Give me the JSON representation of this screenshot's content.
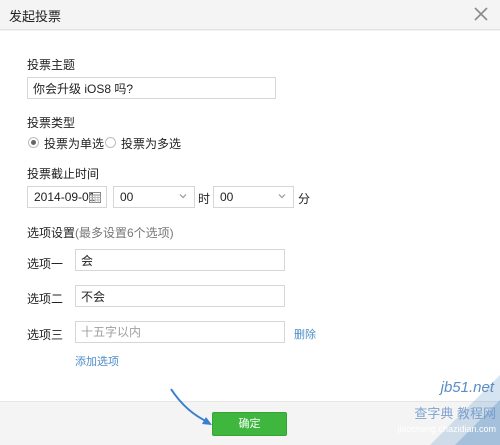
{
  "dialog": {
    "title": "发起投票"
  },
  "form": {
    "topic_label": "投票主题",
    "topic_value": "你会升级 iOS8 吗?",
    "type_label": "投票类型",
    "type_single": "投票为单选",
    "type_multi": "投票为多选",
    "deadline_label": "投票截止时间",
    "date_value": "2014-09-01",
    "hour_value": "00",
    "hour_unit": "时",
    "minute_value": "00",
    "minute_unit": "分",
    "options_label": "选项设置",
    "options_hint": "(最多设置6个选项)",
    "options": [
      {
        "label": "选项一",
        "value": "会",
        "placeholder": ""
      },
      {
        "label": "选项二",
        "value": "不会",
        "placeholder": ""
      },
      {
        "label": "选项三",
        "value": "",
        "placeholder": "十五字以内"
      }
    ],
    "delete_label": "删除",
    "add_option_label": "添加选项"
  },
  "footer": {
    "confirm_label": "确定"
  },
  "watermark": {
    "site": "jb51.net",
    "cn": "查字典 教程网",
    "url": "jiaocheng.chazidian.com"
  },
  "colors": {
    "accent_green": "#3fb73f",
    "link_blue": "#4d8dc9",
    "arrow_blue": "#3a7fd0"
  }
}
